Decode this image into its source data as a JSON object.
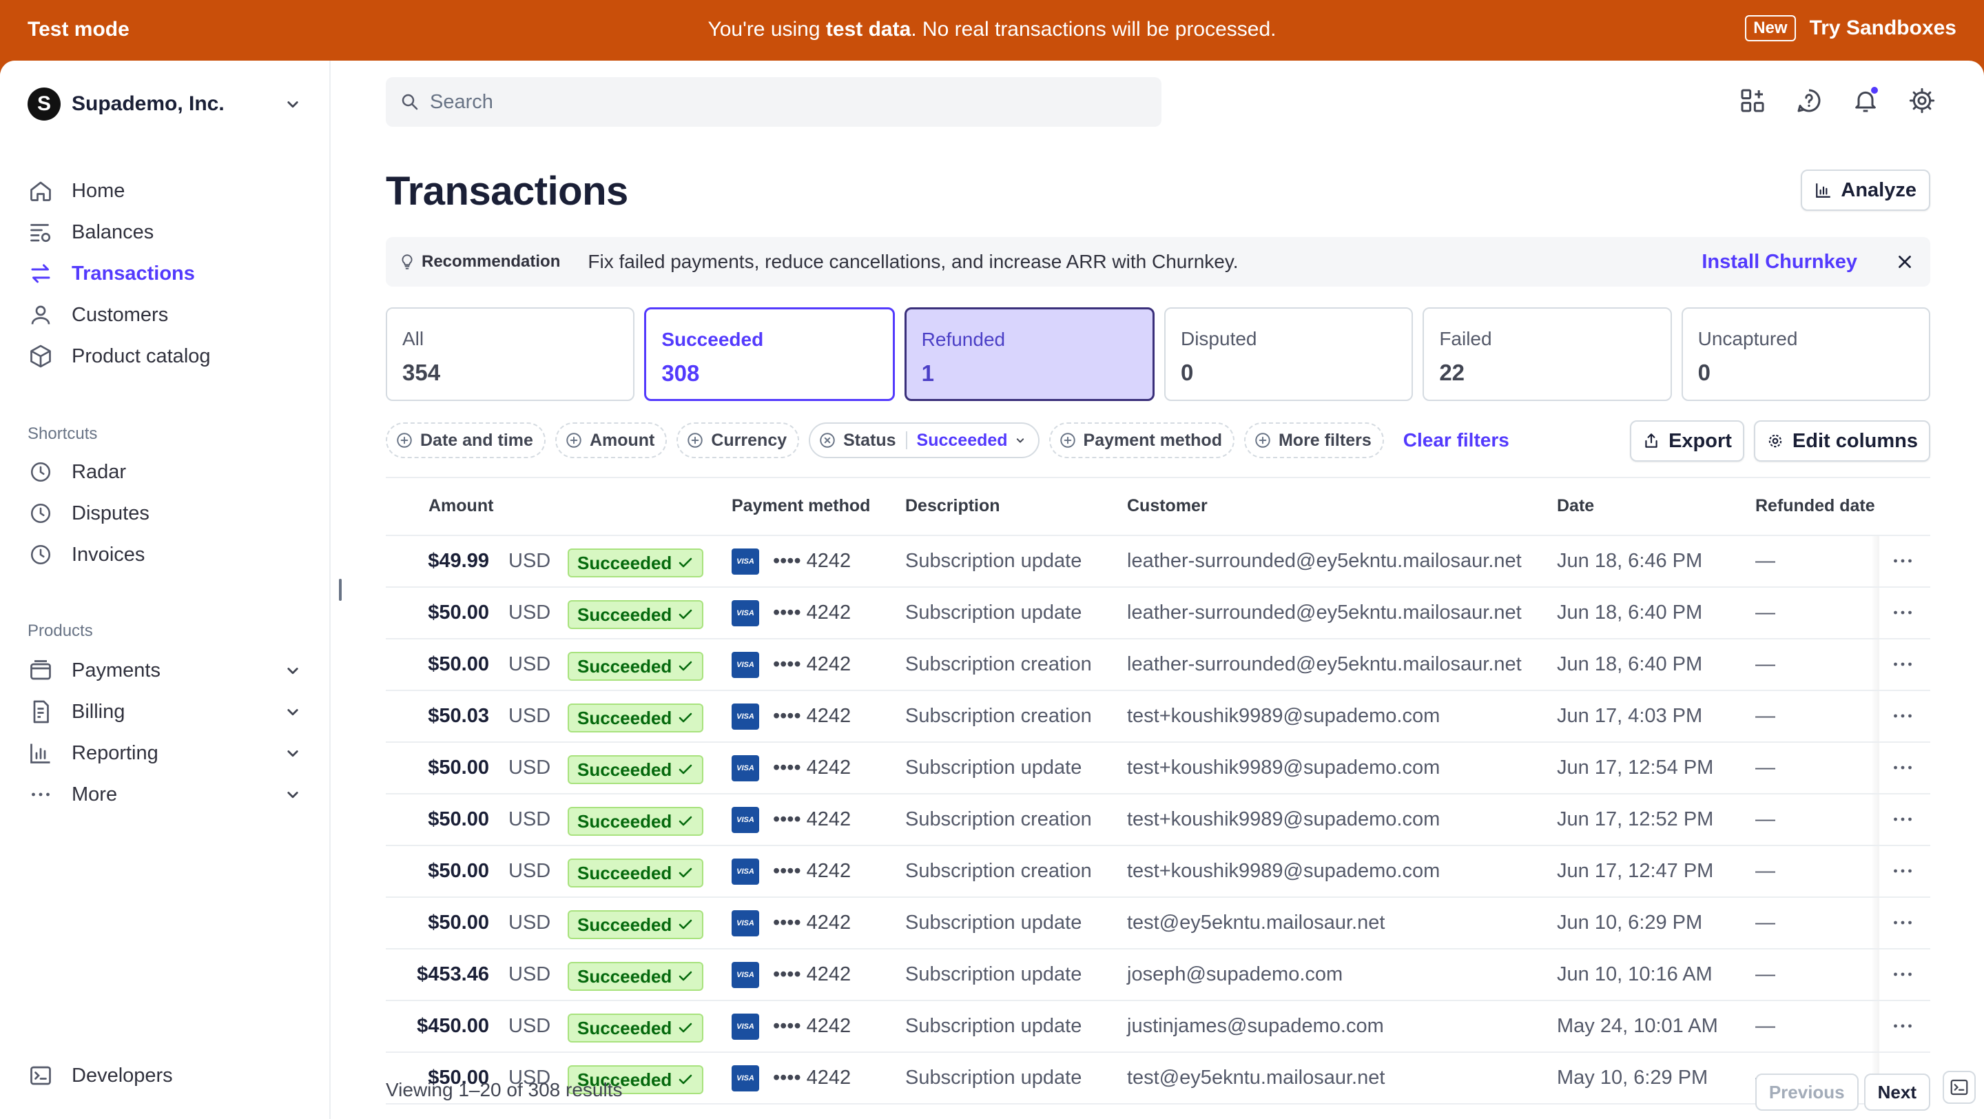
{
  "banner": {
    "mode": "Test mode",
    "message_pre": "You're using ",
    "message_bold": "test data",
    "message_post": ". No real transactions will be processed.",
    "new_badge": "New",
    "sandbox_link": "Try Sandboxes"
  },
  "account": {
    "initial": "S",
    "name": "Supademo, Inc."
  },
  "sidebar": {
    "main_items": [
      {
        "label": "Home",
        "icon": "home-icon"
      },
      {
        "label": "Balances",
        "icon": "balances-icon"
      },
      {
        "label": "Transactions",
        "icon": "transactions-icon"
      },
      {
        "label": "Customers",
        "icon": "customers-icon"
      },
      {
        "label": "Product catalog",
        "icon": "product-catalog-icon"
      }
    ],
    "shortcuts_label": "Shortcuts",
    "shortcuts": [
      {
        "label": "Radar",
        "icon": "clock-icon"
      },
      {
        "label": "Disputes",
        "icon": "clock-icon"
      },
      {
        "label": "Invoices",
        "icon": "clock-icon"
      }
    ],
    "products_label": "Products",
    "products": [
      {
        "label": "Payments",
        "icon": "payments-icon"
      },
      {
        "label": "Billing",
        "icon": "billing-icon"
      },
      {
        "label": "Reporting",
        "icon": "reporting-icon"
      },
      {
        "label": "More",
        "icon": "more-horizontal-icon"
      }
    ],
    "developers": "Developers"
  },
  "search": {
    "placeholder": "Search"
  },
  "page": {
    "title": "Transactions",
    "analyze": "Analyze"
  },
  "recommendation": {
    "label": "Recommendation",
    "message": "Fix failed payments, reduce cancellations, and increase ARR with Churnkey.",
    "action": "Install Churnkey"
  },
  "tabs": [
    {
      "label": "All",
      "count": "354"
    },
    {
      "label": "Succeeded",
      "count": "308"
    },
    {
      "label": "Refunded",
      "count": "1"
    },
    {
      "label": "Disputed",
      "count": "0"
    },
    {
      "label": "Failed",
      "count": "22"
    },
    {
      "label": "Uncaptured",
      "count": "0"
    }
  ],
  "filters": {
    "date": "Date and time",
    "amount": "Amount",
    "currency": "Currency",
    "status": "Status",
    "status_value": "Succeeded",
    "payment_method": "Payment method",
    "more": "More filters",
    "clear": "Clear filters",
    "export": "Export",
    "edit_columns": "Edit columns"
  },
  "table": {
    "headers": {
      "amount": "Amount",
      "payment_method": "Payment method",
      "description": "Description",
      "customer": "Customer",
      "date": "Date",
      "refunded_date": "Refunded date"
    },
    "visa": "VISA",
    "rows": [
      {
        "amount": "$49.99",
        "currency": "USD",
        "status": "Succeeded",
        "card": "•••• 4242",
        "description": "Subscription update",
        "customer": "leather-surrounded@ey5ekntu.mailosaur.net",
        "date": "Jun 18, 6:46 PM",
        "refunded": "—"
      },
      {
        "amount": "$50.00",
        "currency": "USD",
        "status": "Succeeded",
        "card": "•••• 4242",
        "description": "Subscription update",
        "customer": "leather-surrounded@ey5ekntu.mailosaur.net",
        "date": "Jun 18, 6:40 PM",
        "refunded": "—"
      },
      {
        "amount": "$50.00",
        "currency": "USD",
        "status": "Succeeded",
        "card": "•••• 4242",
        "description": "Subscription creation",
        "customer": "leather-surrounded@ey5ekntu.mailosaur.net",
        "date": "Jun 18, 6:40 PM",
        "refunded": "—"
      },
      {
        "amount": "$50.03",
        "currency": "USD",
        "status": "Succeeded",
        "card": "•••• 4242",
        "description": "Subscription creation",
        "customer": "test+koushik9989@supademo.com",
        "date": "Jun 17, 4:03 PM",
        "refunded": "—"
      },
      {
        "amount": "$50.00",
        "currency": "USD",
        "status": "Succeeded",
        "card": "•••• 4242",
        "description": "Subscription update",
        "customer": "test+koushik9989@supademo.com",
        "date": "Jun 17, 12:54 PM",
        "refunded": "—"
      },
      {
        "amount": "$50.00",
        "currency": "USD",
        "status": "Succeeded",
        "card": "•••• 4242",
        "description": "Subscription creation",
        "customer": "test+koushik9989@supademo.com",
        "date": "Jun 17, 12:52 PM",
        "refunded": "—"
      },
      {
        "amount": "$50.00",
        "currency": "USD",
        "status": "Succeeded",
        "card": "•••• 4242",
        "description": "Subscription creation",
        "customer": "test+koushik9989@supademo.com",
        "date": "Jun 17, 12:47 PM",
        "refunded": "—"
      },
      {
        "amount": "$50.00",
        "currency": "USD",
        "status": "Succeeded",
        "card": "•••• 4242",
        "description": "Subscription update",
        "customer": "test@ey5ekntu.mailosaur.net",
        "date": "Jun 10, 6:29 PM",
        "refunded": "—"
      },
      {
        "amount": "$453.46",
        "currency": "USD",
        "status": "Succeeded",
        "card": "•••• 4242",
        "description": "Subscription update",
        "customer": "joseph@supademo.com",
        "date": "Jun 10, 10:16 AM",
        "refunded": "—"
      },
      {
        "amount": "$450.00",
        "currency": "USD",
        "status": "Succeeded",
        "card": "•••• 4242",
        "description": "Subscription update",
        "customer": "justinjames@supademo.com",
        "date": "May 24, 10:01 AM",
        "refunded": "—"
      },
      {
        "amount": "$50.00",
        "currency": "USD",
        "status": "Succeeded",
        "card": "•••• 4242",
        "description": "Subscription update",
        "customer": "test@ey5ekntu.mailosaur.net",
        "date": "May 10, 6:29 PM",
        "refunded": "—"
      }
    ]
  },
  "footer": {
    "summary": "Viewing 1–20 of 308 results",
    "previous": "Previous",
    "next": "Next"
  },
  "colors": {
    "banner": "#c94f0a",
    "accent": "#533afd",
    "success_bg": "#d7f7c2",
    "success_text": "#05690d"
  }
}
